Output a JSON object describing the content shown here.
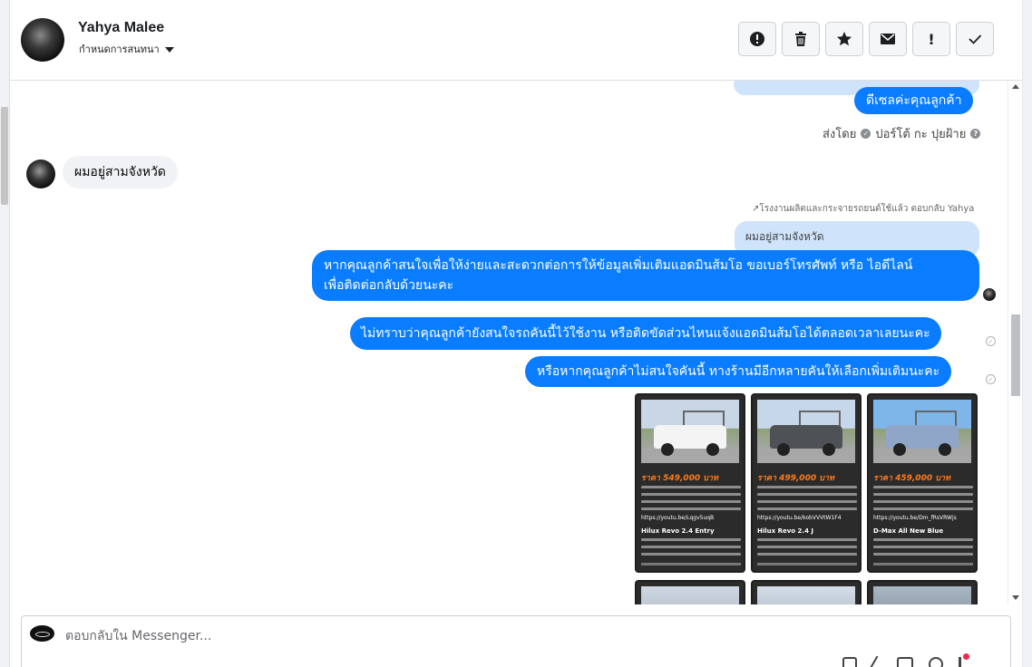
{
  "contact": {
    "name": "Yahya Malee",
    "assign_label": "กำหนดการสนทนา"
  },
  "toolbar": {
    "spam_label": "!",
    "icons": [
      "report-icon",
      "trash-icon",
      "star-icon",
      "envelope-icon",
      "exclamation-icon",
      "checkmark-icon"
    ]
  },
  "messages": {
    "out_top": "ดีเซลค่ะคุณลูกค้า",
    "sent_by_prefix": "ส่งโดย",
    "sent_by_name": "ปอร์โต้ กะ ปุยฝ้าย",
    "in_msg": "ผมอยู่สามจังหวัด",
    "reply_label": "โรงงานผลิตและกระจายรถยนต์ใช้แล้ว ตอบกลับ Yahya",
    "reply_quote": "ผมอยู่สามจังหวัด",
    "out_long_line1": "หากคุณลูกค้าสนใจเพื่อให้ง่ายและสะดวกต่อการให้ข้อมูลเพิ่มเติมแอดมินส้มโอ ขอเบอร์โทรศัพท์ หรือ ไอดีไลน์",
    "out_long_line2": "เพื่อติดต่อกลับด้วยนะคะ",
    "out_2": "ไม่ทราบว่าคุณลูกค้ายังสนใจรถคันนี้ไว้ใช้งาน หรือติดขัดส่วนไหนแจ้งแอดมินส้มโอได้ตลอดเวลาเลยนะคะ",
    "out_3": "หรือหากคุณลูกค้าไม่สนใจคันนี้ ทางร้านมีอีกหลายคันให้เลือกเพิ่มเติมนะคะ"
  },
  "cards": [
    {
      "price": "ราคา 549,000 บาท",
      "link": "https://youtu.be/Lqgv5uqB",
      "model": "Hilux Revo 2.4 Entry",
      "body_color": "#f4f4f4",
      "sky": "#c9d6e6"
    },
    {
      "price": "ราคา 499,000 บาท",
      "link": "https://youtu.be/kobVVVtW1F4",
      "model": "Hilux Revo 2.4 J",
      "body_color": "#4e5257",
      "sky": "#c7d7ea"
    },
    {
      "price": "ราคา 459,000 บาท",
      "link": "https://youtu.be/Dm_fRsVRWjs",
      "model": "D-Max All New Blue",
      "body_color": "#8fa6c8",
      "sky": "#7fb6ea"
    }
  ],
  "composer": {
    "placeholder": "ตอบกลับใน Messenger..."
  }
}
